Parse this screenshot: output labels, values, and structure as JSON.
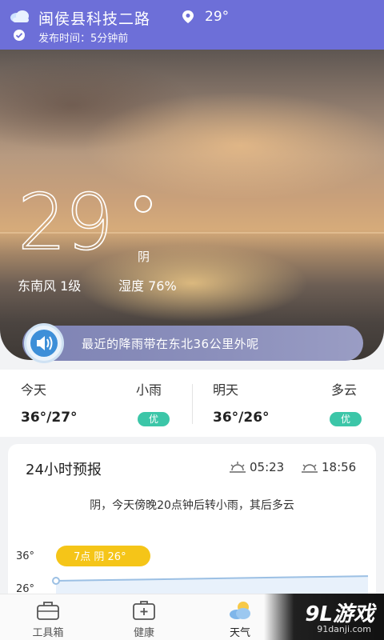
{
  "header": {
    "location": "闽侯县科技二路",
    "temperature": "29°",
    "publish_time": "发布时间：5分钟前"
  },
  "current": {
    "temperature": "29",
    "condition": "阴",
    "wind": "东南风  1级",
    "humidity": "湿度  76%"
  },
  "notice": {
    "text": "最近的降雨带在东北36公里外呢"
  },
  "days": [
    {
      "label": "今天",
      "weather": "小雨",
      "temps": "36°/27°",
      "aqi": "优"
    },
    {
      "label": "明天",
      "weather": "多云",
      "temps": "36°/26°",
      "aqi": "优"
    }
  ],
  "forecast": {
    "title": "24小时预报",
    "sunrise": "05:23",
    "sunset": "18:56",
    "description": "阴，今天傍晚20点钟后转小雨，其后多云",
    "y_labels": [
      "36°",
      "26°"
    ],
    "tooltip": "7点 阴 26°"
  },
  "chart_data": {
    "type": "line",
    "title": "",
    "ylim": [
      26,
      36
    ],
    "y_ticks": [
      "36°",
      "26°"
    ],
    "series": [
      {
        "values": [
          26,
          26.2,
          26.4,
          26.6,
          26.8,
          27.0,
          27.2,
          27.4
        ]
      }
    ]
  },
  "tabbar": {
    "items": [
      {
        "label": "工具箱",
        "icon": "toolbox-icon"
      },
      {
        "label": "健康",
        "icon": "first-aid-kit-icon"
      },
      {
        "label": "天气",
        "icon": "weather-cloud-sun-icon"
      }
    ]
  },
  "watermark": {
    "text": "9L游戏",
    "url": "91danji.com"
  },
  "colors": {
    "header_bg": "#6d6fd8",
    "badge_green": "#3cc6a8",
    "notice_bg": "#8c90bc",
    "tooltip_yellow": "#f5c518",
    "line_blue": "#9cc0e4"
  }
}
